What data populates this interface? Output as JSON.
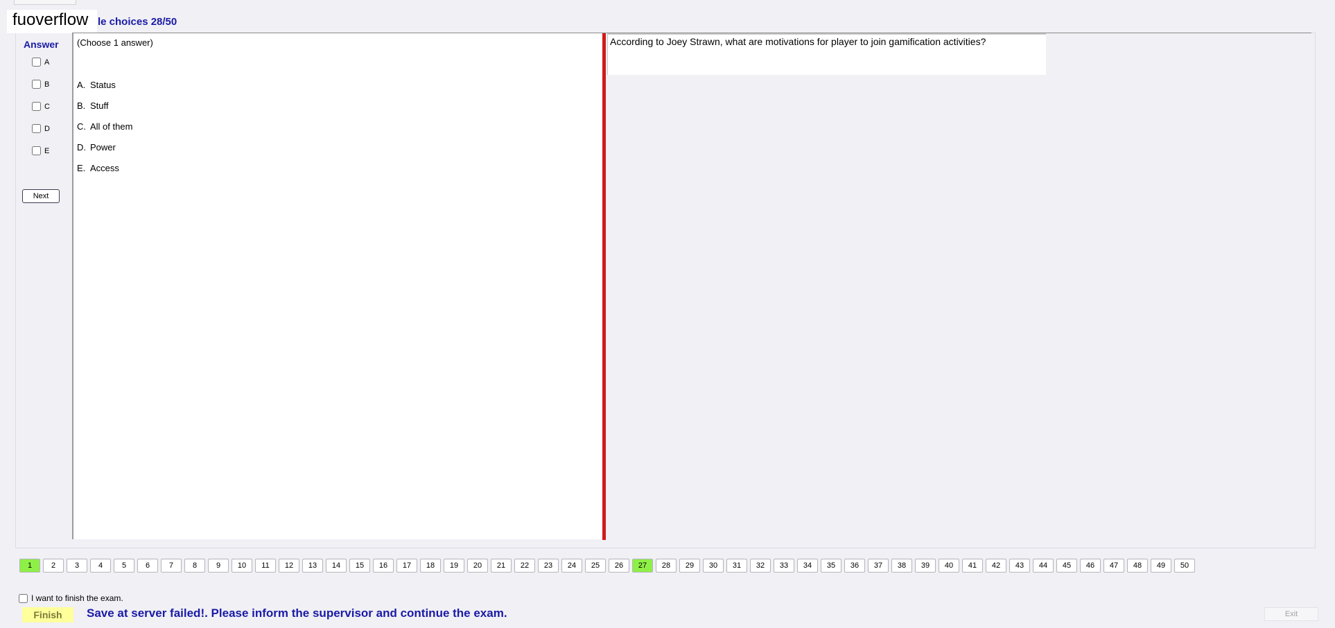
{
  "header": {
    "brand": "fuoverflow",
    "title": "le choices 28/50"
  },
  "answer_panel": {
    "label": "Answer",
    "options": [
      "A",
      "B",
      "C",
      "D",
      "E"
    ],
    "next_label": "Next"
  },
  "question": {
    "instruction": "(Choose 1 answer)",
    "text": "According to Joey Strawn, what are motivations for player to join gamification activities?",
    "answers": [
      {
        "letter": "A.",
        "text": "Status"
      },
      {
        "letter": "B.",
        "text": "Stuff"
      },
      {
        "letter": "C.",
        "text": "All of them"
      },
      {
        "letter": "D.",
        "text": "Power"
      },
      {
        "letter": "E.",
        "text": "Access"
      }
    ]
  },
  "nav": {
    "pages": [
      "1",
      "2",
      "3",
      "4",
      "5",
      "6",
      "7",
      "8",
      "9",
      "10",
      "11",
      "12",
      "13",
      "14",
      "15",
      "16",
      "17",
      "18",
      "19",
      "20",
      "21",
      "22",
      "23",
      "24",
      "25",
      "26",
      "27",
      "28",
      "29",
      "30",
      "31",
      "32",
      "33",
      "34",
      "35",
      "36",
      "37",
      "38",
      "39",
      "40",
      "41",
      "42",
      "43",
      "44",
      "45",
      "46",
      "47",
      "48",
      "49",
      "50"
    ],
    "answered": [
      "1",
      "27"
    ],
    "answered_color": "#8ef046"
  },
  "footer": {
    "finish_check_label": "I want to finish the exam.",
    "finish_label": "Finish",
    "status_message": "Save at server failed!. Please inform the supervisor and continue the exam.",
    "exit_label": "Exit"
  },
  "colors": {
    "accent_blue": "#1a1aa6",
    "divider_red": "#d21a1a",
    "finish_yellow": "#ffff9c"
  }
}
